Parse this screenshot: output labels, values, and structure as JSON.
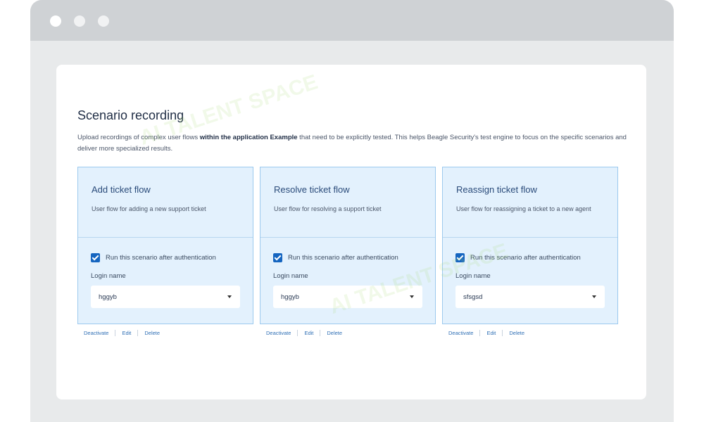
{
  "page": {
    "title": "Scenario recording",
    "description_before": "Upload recordings of complex user flows ",
    "description_bold": "within the application Example",
    "description_after": " that need to be explicitly tested. This helps Beagle Security's test engine to focus on the specific scenarios and deliver more specialized results."
  },
  "cards": [
    {
      "title": "Add ticket flow",
      "subtitle": "User flow for adding a new support ticket",
      "checkbox_label": "Run this scenario after authentication",
      "checked": true,
      "login_label": "Login name",
      "login_value": "hggyb"
    },
    {
      "title": "Resolve ticket flow",
      "subtitle": "User flow for resolving a support ticket",
      "checkbox_label": "Run this scenario after authentication",
      "checked": true,
      "login_label": "Login name",
      "login_value": "hggyb"
    },
    {
      "title": "Reassign ticket flow",
      "subtitle": "User flow for reassigning a ticket to a new agent",
      "checkbox_label": "Run this scenario after authentication",
      "checked": true,
      "login_label": "Login name",
      "login_value": "sfsgsd"
    }
  ],
  "actions": {
    "deactivate": "Deactivate",
    "edit": "Edit",
    "delete": "Delete"
  },
  "watermark": "AI TALENT SPACE",
  "colors": {
    "accent": "#1565c0",
    "card_background": "#e3f1fd",
    "card_border": "#9cc9ee",
    "link": "#2f6fb5"
  }
}
